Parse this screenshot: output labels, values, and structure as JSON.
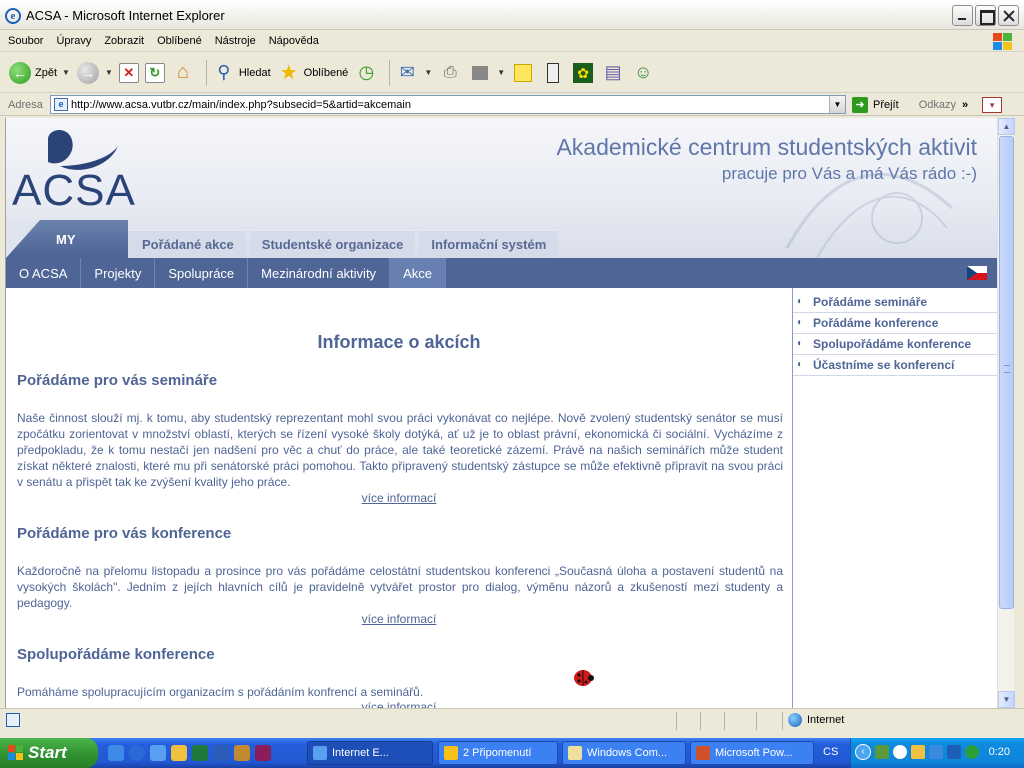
{
  "window": {
    "title": "ACSA - Microsoft Internet Explorer"
  },
  "menu": [
    "Soubor",
    "Úpravy",
    "Zobrazit",
    "Oblíbené",
    "Nástroje",
    "Nápověda"
  ],
  "toolbar": {
    "back": "Zpět",
    "search": "Hledat",
    "favorites": "Oblíbené"
  },
  "address": {
    "label": "Adresa",
    "url": "http://www.acsa.vutbr.cz/main/index.php?subsecid=5&artid=akcemain",
    "go": "Přejít",
    "links": "Odkazy"
  },
  "site": {
    "logo_text": "ACSA",
    "slogan_line1": "Akademické centrum studentských aktivit",
    "slogan_line2": "pracuje pro Vás a má Vás rádo :-)",
    "tab_my": "MY",
    "main_tabs": [
      "Pořádané akce",
      "Studentské organizace",
      "Informační systém"
    ],
    "subnav": [
      "O ACSA",
      "Projekty",
      "Spolupráce",
      "Mezinárodní aktivity",
      "Akce"
    ],
    "page_title": "Informace o akcích",
    "sections": [
      {
        "heading": "Pořádáme pro vás semináře",
        "text": "Naše činnost slouží mj. k tomu, aby studentský reprezentant mohl svou práci vykonávat co nejlépe. Nově zvolený studentský senátor se musí zpočátku zorientovat v množství oblastí, kterých se řízení vysoké školy dotýká, ať už je to oblast právní, ekonomická či sociální. Vycházíme z předpokladu, že k tomu nestačí jen nadšení pro věc a chuť do práce, ale také teoretické zázemí. Právě na našich seminářích může student získat některé znalosti, které mu při senátorské práci pomohou. Takto připravený studentský zástupce se může efektivně připravit na svou práci v senátu a přispět tak ke zvýšení kvality jeho práce.",
        "more": "více informací"
      },
      {
        "heading": "Pořádáme pro vás konference",
        "text": "Každoročně na přelomu listopadu a prosince pro vás pořádáme celostátní studentskou konferenci „Současná úloha a postavení studentů na vysokých školách\". Jedním z jejích hlavních cílů je pravidelně vytvářet prostor pro dialog, výměnu názorů a zkušeností mezi studenty a pedagogy.",
        "more": "více informací"
      },
      {
        "heading": "Spolupořádáme konference",
        "text": "Pomáháme spolupracujícím organizacím s pořádáním konfrencí a seminářů.",
        "more": "více informací"
      }
    ],
    "sidebar": [
      "Pořádáme semináře",
      "Pořádáme konference",
      "Spolupořádáme konference",
      "Účastníme se konferencí"
    ]
  },
  "status": {
    "zone": "Internet"
  },
  "taskbar": {
    "start": "Start",
    "tasks": [
      "Internet E...",
      "2 Připomenutí",
      "Windows Com...",
      "Microsoft Pow..."
    ],
    "lang": "CS",
    "clock": "0:20"
  },
  "colors": {
    "site_text": "#4e6596",
    "subnav_bg": "#4e6596",
    "taskbar_blue": "#245edb"
  }
}
